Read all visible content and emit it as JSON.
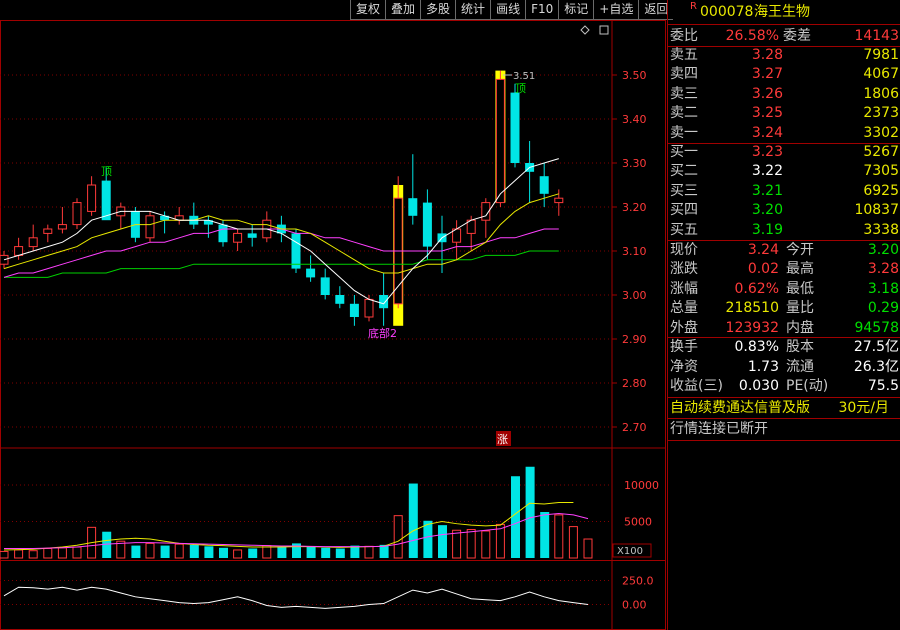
{
  "toolbar": {
    "buttons": [
      "复权",
      "叠加",
      "多股",
      "统计",
      "画线",
      "F10",
      "标记",
      "+自选",
      "返回"
    ]
  },
  "stock": {
    "badge": "R",
    "code": "000078",
    "name": "海王生物"
  },
  "order_ratio": {
    "label": "委比",
    "value": "26.58%",
    "diff_label": "委差",
    "diff": "14143"
  },
  "asks": [
    {
      "label": "卖五",
      "price": "3.28",
      "vol": "7981"
    },
    {
      "label": "卖四",
      "price": "3.27",
      "vol": "4067"
    },
    {
      "label": "卖三",
      "price": "3.26",
      "vol": "1806"
    },
    {
      "label": "卖二",
      "price": "3.25",
      "vol": "2373"
    },
    {
      "label": "卖一",
      "price": "3.24",
      "vol": "3302"
    }
  ],
  "bids": [
    {
      "label": "买一",
      "price": "3.23",
      "vol": "5267",
      "color": "#ff3a3a"
    },
    {
      "label": "买二",
      "price": "3.22",
      "vol": "7305",
      "color": "#ffffff"
    },
    {
      "label": "买三",
      "price": "3.21",
      "vol": "6925",
      "color": "#00e000"
    },
    {
      "label": "买四",
      "price": "3.20",
      "vol": "10837",
      "color": "#00e000"
    },
    {
      "label": "买五",
      "price": "3.19",
      "vol": "3338",
      "color": "#00e000"
    }
  ],
  "quote": [
    {
      "l1": "现价",
      "v1": "3.24",
      "c1": "#ff3a3a",
      "l2": "今开",
      "v2": "3.20",
      "c2": "#00e000"
    },
    {
      "l1": "涨跌",
      "v1": "0.02",
      "c1": "#ff3a3a",
      "l2": "最高",
      "v2": "3.28",
      "c2": "#ff3a3a"
    },
    {
      "l1": "涨幅",
      "v1": "0.62%",
      "c1": "#ff3a3a",
      "l2": "最低",
      "v2": "3.18",
      "c2": "#00e000"
    },
    {
      "l1": "总量",
      "v1": "218510",
      "c1": "#e8e800",
      "l2": "量比",
      "v2": "0.29",
      "c2": "#00e000"
    },
    {
      "l1": "外盘",
      "v1": "123932",
      "c1": "#ff3a3a",
      "l2": "内盘",
      "v2": "94578",
      "c2": "#00e000"
    }
  ],
  "fundamentals": [
    {
      "l1": "换手",
      "v1": "0.83%",
      "l2": "股本",
      "v2": "27.5亿"
    },
    {
      "l1": "净资",
      "v1": "1.73",
      "l2": "流通",
      "v2": "26.3亿"
    },
    {
      "l1": "收益(三)",
      "v1": "0.030",
      "l2": "PE(动)",
      "v2": "75.5"
    }
  ],
  "promo": {
    "text": "自动续费通达信普及版",
    "price": "30元/月"
  },
  "status": {
    "text": "行情连接已断开"
  },
  "colors": {
    "up": "#ff3a3a",
    "down": "#00e5e5",
    "ma5": "#ffffff",
    "ma10": "#e8e800",
    "ma20": "#ff40ff",
    "ma60": "#00d000",
    "border": "#a00000",
    "marker": "#ffff00"
  },
  "chart_data": {
    "type": "candlestick",
    "price_axis": {
      "ticks": [
        "3.50",
        "3.40",
        "3.30",
        "3.20",
        "3.10",
        "3.00",
        "2.90",
        "2.80",
        "2.70"
      ],
      "range": [
        2.66,
        3.59
      ]
    },
    "volume_axis": {
      "ticks": [
        "10000",
        "5000"
      ],
      "unit": "X100",
      "range": [
        0,
        13000
      ]
    },
    "indicator_axis": {
      "ticks": [
        "250.0",
        "0.00"
      ],
      "range": [
        -50,
        300
      ]
    },
    "annotations": {
      "high_label": "3.51",
      "top_marks": [
        "顶",
        "顶"
      ],
      "bottom_mark": "底部2",
      "up_mark": "涨"
    },
    "candles": [
      {
        "o": 3.07,
        "h": 3.1,
        "l": 3.06,
        "c": 3.09
      },
      {
        "o": 3.09,
        "h": 3.13,
        "l": 3.08,
        "c": 3.11
      },
      {
        "o": 3.11,
        "h": 3.16,
        "l": 3.1,
        "c": 3.13
      },
      {
        "o": 3.14,
        "h": 3.16,
        "l": 3.12,
        "c": 3.15
      },
      {
        "o": 3.15,
        "h": 3.2,
        "l": 3.14,
        "c": 3.16
      },
      {
        "o": 3.16,
        "h": 3.22,
        "l": 3.15,
        "c": 3.21
      },
      {
        "o": 3.19,
        "h": 3.27,
        "l": 3.18,
        "c": 3.25
      },
      {
        "o": 3.26,
        "h": 3.29,
        "l": 3.18,
        "c": 3.17
      },
      {
        "o": 3.18,
        "h": 3.21,
        "l": 3.15,
        "c": 3.2
      },
      {
        "o": 3.19,
        "h": 3.2,
        "l": 3.12,
        "c": 3.13
      },
      {
        "o": 3.13,
        "h": 3.19,
        "l": 3.12,
        "c": 3.18
      },
      {
        "o": 3.18,
        "h": 3.19,
        "l": 3.14,
        "c": 3.17
      },
      {
        "o": 3.17,
        "h": 3.2,
        "l": 3.16,
        "c": 3.18
      },
      {
        "o": 3.18,
        "h": 3.21,
        "l": 3.15,
        "c": 3.16
      },
      {
        "o": 3.17,
        "h": 3.18,
        "l": 3.13,
        "c": 3.16
      },
      {
        "o": 3.16,
        "h": 3.17,
        "l": 3.11,
        "c": 3.12
      },
      {
        "o": 3.12,
        "h": 3.15,
        "l": 3.1,
        "c": 3.14
      },
      {
        "o": 3.14,
        "h": 3.16,
        "l": 3.11,
        "c": 3.13
      },
      {
        "o": 3.13,
        "h": 3.19,
        "l": 3.12,
        "c": 3.17
      },
      {
        "o": 3.16,
        "h": 3.18,
        "l": 3.12,
        "c": 3.14
      },
      {
        "o": 3.14,
        "h": 3.15,
        "l": 3.05,
        "c": 3.06
      },
      {
        "o": 3.06,
        "h": 3.09,
        "l": 3.03,
        "c": 3.04
      },
      {
        "o": 3.04,
        "h": 3.06,
        "l": 2.99,
        "c": 3.0
      },
      {
        "o": 3.0,
        "h": 3.02,
        "l": 2.97,
        "c": 2.98
      },
      {
        "o": 2.98,
        "h": 3.0,
        "l": 2.93,
        "c": 2.95
      },
      {
        "o": 2.95,
        "h": 3.0,
        "l": 2.94,
        "c": 2.99
      },
      {
        "o": 3.0,
        "h": 3.05,
        "l": 2.93,
        "c": 2.97
      },
      {
        "o": 2.98,
        "h": 3.27,
        "l": 2.97,
        "c": 3.22
      },
      {
        "o": 3.22,
        "h": 3.32,
        "l": 3.16,
        "c": 3.18
      },
      {
        "o": 3.21,
        "h": 3.24,
        "l": 3.08,
        "c": 3.11
      },
      {
        "o": 3.14,
        "h": 3.18,
        "l": 3.05,
        "c": 3.12
      },
      {
        "o": 3.12,
        "h": 3.17,
        "l": 3.08,
        "c": 3.15
      },
      {
        "o": 3.14,
        "h": 3.18,
        "l": 3.1,
        "c": 3.17
      },
      {
        "o": 3.17,
        "h": 3.22,
        "l": 3.13,
        "c": 3.21
      },
      {
        "o": 3.21,
        "h": 3.51,
        "l": 3.2,
        "c": 3.49
      },
      {
        "o": 3.46,
        "h": 3.48,
        "l": 3.29,
        "c": 3.3
      },
      {
        "o": 3.3,
        "h": 3.35,
        "l": 3.21,
        "c": 3.28
      },
      {
        "o": 3.27,
        "h": 3.3,
        "l": 3.2,
        "c": 3.23
      },
      {
        "o": 3.21,
        "h": 3.24,
        "l": 3.18,
        "c": 3.22
      }
    ],
    "markers": [
      {
        "index": 27,
        "low": 2.93,
        "high": 3.25
      },
      {
        "index": 34,
        "low": 3.21,
        "high": 3.51
      }
    ],
    "ma": {
      "ma5": [
        3.08,
        3.09,
        3.1,
        3.11,
        3.12,
        3.14,
        3.17,
        3.18,
        3.19,
        3.19,
        3.19,
        3.18,
        3.17,
        3.17,
        3.17,
        3.16,
        3.15,
        3.15,
        3.15,
        3.14,
        3.12,
        3.1,
        3.07,
        3.04,
        3.01,
        2.99,
        2.98,
        3.02,
        3.06,
        3.09,
        3.13,
        3.15,
        3.17,
        3.18,
        3.23,
        3.26,
        3.29,
        3.3,
        3.31
      ],
      "ma10": [
        3.06,
        3.07,
        3.08,
        3.09,
        3.1,
        3.11,
        3.13,
        3.14,
        3.15,
        3.16,
        3.16,
        3.17,
        3.17,
        3.17,
        3.18,
        3.17,
        3.17,
        3.16,
        3.16,
        3.15,
        3.15,
        3.14,
        3.12,
        3.1,
        3.08,
        3.06,
        3.05,
        3.05,
        3.06,
        3.07,
        3.07,
        3.08,
        3.1,
        3.12,
        3.16,
        3.19,
        3.21,
        3.22,
        3.23
      ],
      "ma20": [
        3.04,
        3.05,
        3.05,
        3.06,
        3.07,
        3.08,
        3.09,
        3.1,
        3.1,
        3.11,
        3.12,
        3.12,
        3.13,
        3.14,
        3.14,
        3.15,
        3.15,
        3.15,
        3.15,
        3.15,
        3.14,
        3.14,
        3.13,
        3.13,
        3.12,
        3.11,
        3.1,
        3.1,
        3.1,
        3.1,
        3.1,
        3.11,
        3.11,
        3.12,
        3.13,
        3.13,
        3.14,
        3.15,
        3.15
      ],
      "ma60": [
        3.04,
        3.04,
        3.04,
        3.04,
        3.05,
        3.05,
        3.05,
        3.05,
        3.06,
        3.06,
        3.06,
        3.06,
        3.06,
        3.07,
        3.07,
        3.07,
        3.07,
        3.07,
        3.07,
        3.07,
        3.07,
        3.07,
        3.07,
        3.07,
        3.07,
        3.07,
        3.07,
        3.07,
        3.07,
        3.08,
        3.08,
        3.08,
        3.08,
        3.09,
        3.09,
        3.09,
        3.1,
        3.1,
        3.1
      ]
    },
    "volume": [
      900,
      1100,
      1000,
      1300,
      1400,
      1500,
      4200,
      3600,
      2300,
      1700,
      2000,
      1700,
      1900,
      1800,
      1600,
      1400,
      1100,
      1300,
      1700,
      1500,
      2000,
      1600,
      1400,
      1300,
      1700,
      1600,
      1800,
      5800,
      10200,
      5100,
      4500,
      3800,
      3900,
      3700,
      4600,
      11200,
      12500,
      6300,
      5900,
      4300,
      2600
    ],
    "volume_ma": [
      1100,
      1150,
      1200,
      1350,
      1500,
      1750,
      2100,
      2400,
      2600,
      2700,
      2600,
      2300,
      2000,
      1850,
      1750,
      1700,
      1600,
      1500,
      1500,
      1500,
      1550,
      1550,
      1500,
      1450,
      1500,
      1550,
      1600,
      2300,
      3700,
      4600,
      5000,
      4700,
      4500,
      4400,
      4500,
      6000,
      7500,
      7400,
      7600,
      7600
    ],
    "volume_ma2": [
      1300,
      1300,
      1300,
      1350,
      1400,
      1500,
      1700,
      1900,
      2000,
      2100,
      2100,
      2050,
      2000,
      1950,
      1900,
      1850,
      1800,
      1750,
      1700,
      1650,
      1650,
      1600,
      1550,
      1550,
      1550,
      1550,
      1600,
      1900,
      2400,
      2900,
      3200,
      3400,
      3600,
      3800,
      4000,
      4700,
      5500,
      5900,
      6100,
      5900,
      5400
    ],
    "indicator": [
      90,
      180,
      175,
      160,
      180,
      150,
      180,
      160,
      120,
      80,
      60,
      40,
      20,
      10,
      20,
      50,
      80,
      40,
      -10,
      -30,
      -20,
      -30,
      -40,
      -30,
      -20,
      0,
      10,
      80,
      150,
      120,
      160,
      110,
      60,
      50,
      40,
      80,
      130,
      80,
      40,
      20,
      0
    ]
  }
}
